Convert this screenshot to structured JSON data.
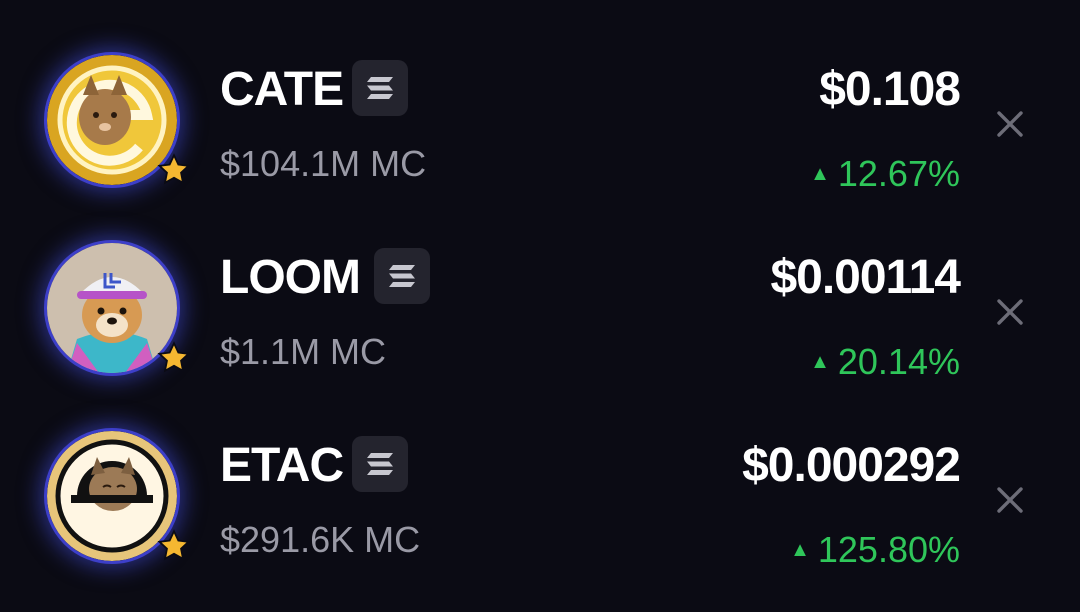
{
  "watchlist": [
    {
      "name": "CATE",
      "chain_icon": "solana-icon",
      "market_cap": "$104.1M MC",
      "price": "$0.108",
      "change": "12.67%",
      "change_direction": "up",
      "favorite_icon": "star-icon",
      "remove_icon": "close-icon"
    },
    {
      "name": "LOOM",
      "chain_icon": "solana-icon",
      "market_cap": "$1.1M MC",
      "price": "$0.00114",
      "change": "20.14%",
      "change_direction": "up",
      "favorite_icon": "star-icon",
      "remove_icon": "close-icon"
    },
    {
      "name": "ETAC",
      "chain_icon": "solana-icon",
      "market_cap": "$291.6K MC",
      "price": "$0.000292",
      "change": "125.80%",
      "change_direction": "up",
      "favorite_icon": "star-icon",
      "remove_icon": "close-icon"
    }
  ],
  "colors": {
    "background": "#0b0b14",
    "positive": "#2fc65a",
    "muted": "#9a9aa6",
    "avatar_ring": "#3d3fc9",
    "star": "#f5b731"
  }
}
